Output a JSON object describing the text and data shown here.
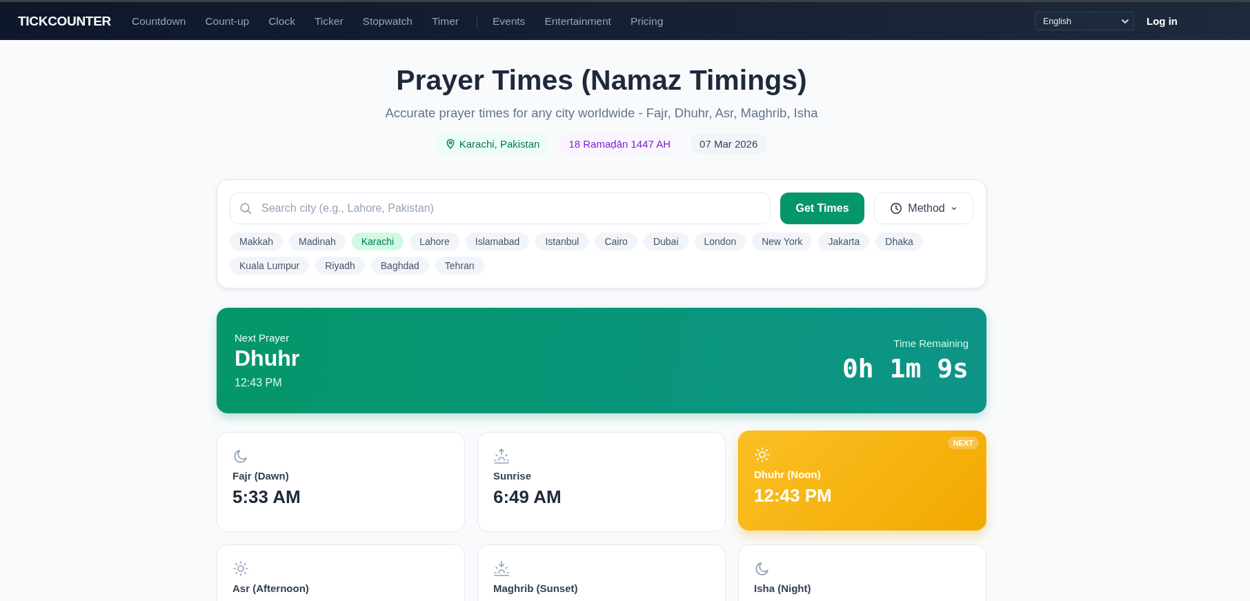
{
  "nav": {
    "logo": "TICKCOUNTER",
    "groups": [
      [
        "Countdown",
        "Count-up",
        "Clock",
        "Ticker",
        "Stopwatch",
        "Timer"
      ],
      [
        "Events",
        "Entertainment",
        "Pricing"
      ]
    ],
    "language": "English",
    "login": "Log in"
  },
  "header": {
    "title": "Prayer Times (Namaz Timings)",
    "subtitle": "Accurate prayer times for any city worldwide - Fajr, Dhuhr, Asr, Maghrib, Isha",
    "location": "Karachi, Pakistan",
    "hijri_date": "18 Ramaḍān 1447 AH",
    "date": "07 Mar 2026"
  },
  "search": {
    "placeholder": "Search city (e.g., Lahore, Pakistan)",
    "submit": "Get Times",
    "method": "Method",
    "cities": [
      {
        "label": "Makkah",
        "selected": false
      },
      {
        "label": "Madinah",
        "selected": false
      },
      {
        "label": "Karachi",
        "selected": true
      },
      {
        "label": "Lahore",
        "selected": false
      },
      {
        "label": "Islamabad",
        "selected": false
      },
      {
        "label": "Istanbul",
        "selected": false
      },
      {
        "label": "Cairo",
        "selected": false
      },
      {
        "label": "Dubai",
        "selected": false
      },
      {
        "label": "London",
        "selected": false
      },
      {
        "label": "New York",
        "selected": false
      },
      {
        "label": "Jakarta",
        "selected": false
      },
      {
        "label": "Dhaka",
        "selected": false
      },
      {
        "label": "Kuala Lumpur",
        "selected": false
      },
      {
        "label": "Riyadh",
        "selected": false
      },
      {
        "label": "Baghdad",
        "selected": false
      },
      {
        "label": "Tehran",
        "selected": false
      }
    ]
  },
  "next_prayer": {
    "label": "Next Prayer",
    "name": "Dhuhr",
    "time": "12:43 PM",
    "remaining_label": "Time Remaining",
    "remaining": "0h 1m 9s"
  },
  "prayers": [
    {
      "kind": "moon",
      "name": "Fajr (Dawn)",
      "time": "5:33 AM",
      "next": false
    },
    {
      "kind": "sunrise",
      "name": "Sunrise",
      "time": "6:49 AM",
      "next": false
    },
    {
      "kind": "sun",
      "name": "Dhuhr (Noon)",
      "time": "12:43 PM",
      "next": true,
      "badge": "NEXT"
    },
    {
      "kind": "sun",
      "name": "Asr (Afternoon)",
      "next": false
    },
    {
      "kind": "sunset",
      "name": "Maghrib (Sunset)",
      "next": false
    },
    {
      "kind": "moon",
      "name": "Isha (Night)",
      "next": false
    }
  ]
}
